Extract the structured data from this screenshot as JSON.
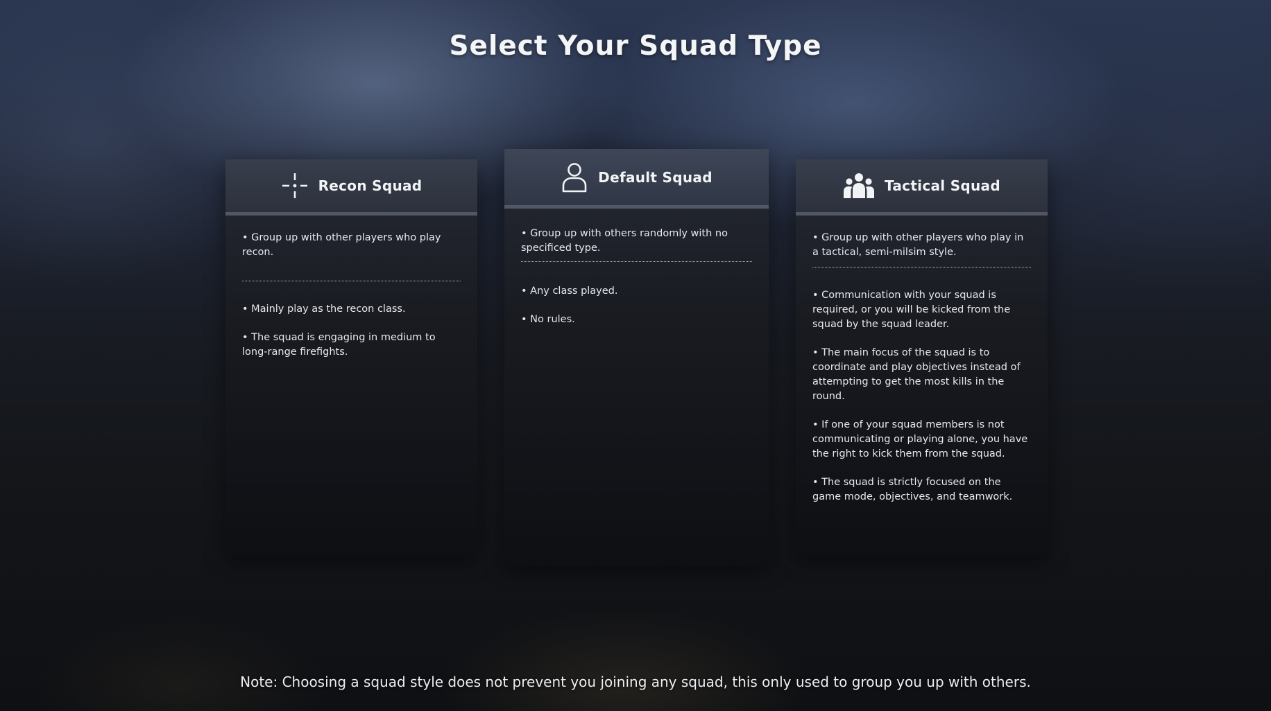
{
  "title": "Select Your Squad Type",
  "cards": [
    {
      "title": "Recon Squad",
      "icon": "crosshair-icon",
      "intro": "• Group up with other players who play recon.",
      "bullets": [
        "• Mainly play as the recon class.",
        "• The squad is engaging in medium to long-range firefights."
      ]
    },
    {
      "title": "Default Squad",
      "icon": "person-icon",
      "intro": "• Group up with others randomly with no specificed type.",
      "bullets": [
        "• Any class played.",
        "• No rules."
      ]
    },
    {
      "title": "Tactical Squad",
      "icon": "group-icon",
      "intro": "• Group up with other players who play in a tactical, semi-milsim style.",
      "bullets": [
        "• Communication with your squad is required, or you will be kicked from the squad by the squad leader.",
        "• The main focus of the squad is to coordinate and play objectives instead of attempting to get the most kills in the round.",
        "• If one of your squad members is not communicating or playing alone, you have the right to kick them from the squad.",
        "• The squad is strictly focused on the game mode, objectives, and teamwork."
      ]
    }
  ],
  "note": "Note: Choosing a squad style does not prevent you joining any squad, this only used to group you up with others."
}
